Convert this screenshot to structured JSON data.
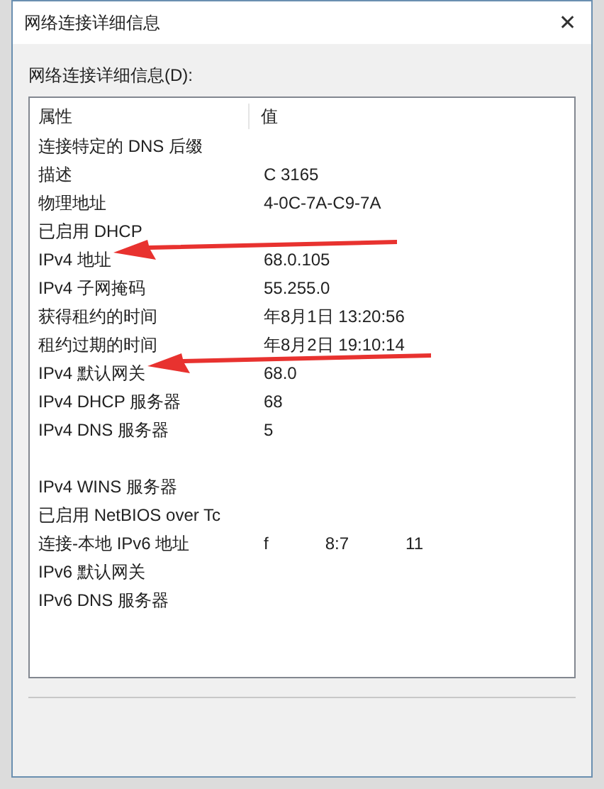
{
  "window": {
    "title": "网络连接详细信息",
    "close": "✕"
  },
  "list_label": "网络连接详细信息(D):",
  "table": {
    "columns": [
      "属性",
      "值"
    ],
    "rows": [
      {
        "property": "连接特定的 DNS 后缀",
        "value": "",
        "arrow": false
      },
      {
        "property": "描述",
        "value": "C 3165",
        "arrow": false
      },
      {
        "property": "物理地址",
        "value": "4-0C-7A-C9-7A",
        "arrow": false
      },
      {
        "property": "已启用 DHCP",
        "value": "",
        "arrow": false
      },
      {
        "property": "IPv4 地址",
        "value": "68.0.105",
        "arrow": true
      },
      {
        "property": "IPv4 子网掩码",
        "value": "55.255.0",
        "arrow": false
      },
      {
        "property": "获得租约的时间",
        "value": "年8月1日 13:20:56",
        "arrow": false
      },
      {
        "property": "租约过期的时间",
        "value": "年8月2日 19:10:14",
        "arrow": false
      },
      {
        "property": "IPv4 默认网关",
        "value": "68.0",
        "arrow": true
      },
      {
        "property": "IPv4 DHCP 服务器",
        "value": "68",
        "arrow": false
      },
      {
        "property": "IPv4 DNS 服务器",
        "value": "5",
        "arrow": false
      },
      {
        "property": "",
        "value": "",
        "arrow": false
      },
      {
        "property": "IPv4 WINS 服务器",
        "value": "",
        "arrow": false
      },
      {
        "property": "已启用 NetBIOS over Tc",
        "value": "",
        "arrow": false
      },
      {
        "property": "连接-本地 IPv6 地址",
        "value": "f",
        "value_extra": [
          "8:7",
          "11"
        ],
        "arrow": false
      },
      {
        "property": "IPv6 默认网关",
        "value": "",
        "arrow": false
      },
      {
        "property": "IPv6 DNS 服务器",
        "value": "",
        "arrow": false
      }
    ]
  }
}
